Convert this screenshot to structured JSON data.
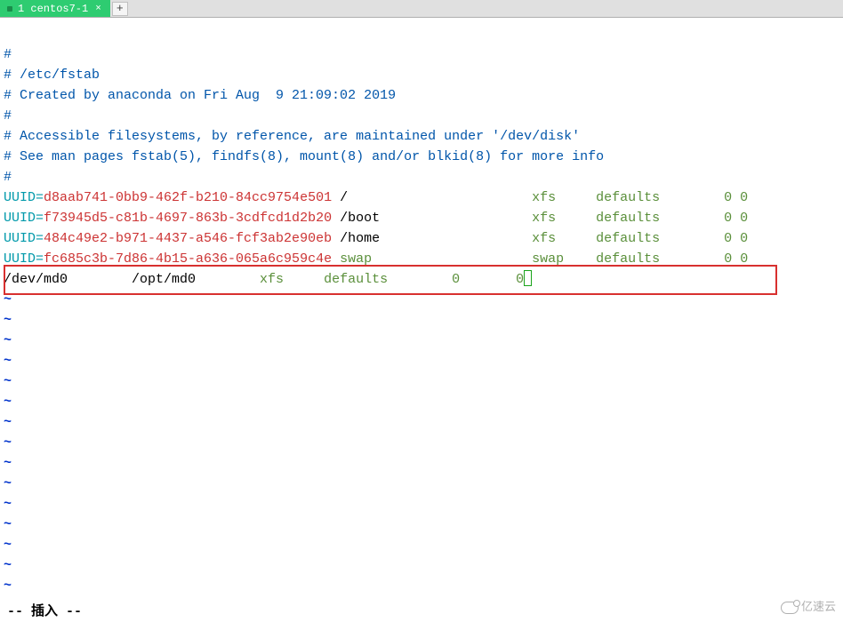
{
  "tab": {
    "title": "1 centos7-1",
    "close": "×",
    "add": "+"
  },
  "file": {
    "comment1": "#",
    "comment2": "# /etc/fstab",
    "comment3": "# Created by anaconda on Fri Aug  9 21:09:02 2019",
    "comment4": "#",
    "comment5": "# Accessible filesystems, by reference, are maintained under '/dev/disk'",
    "comment6": "# See man pages fstab(5), findfs(8), mount(8) and/or blkid(8) for more info",
    "comment7": "#",
    "entries": [
      {
        "key": "UUID=",
        "val": "d8aab741-0bb9-462f-b210-84cc9754e501",
        "mount": " /                       ",
        "fs": "xfs     ",
        "opt": "defaults        ",
        "nums": "0 0"
      },
      {
        "key": "UUID=",
        "val": "f73945d5-c81b-4697-863b-3cdfcd1d2b20",
        "mount": " /boot                   ",
        "fs": "xfs     ",
        "opt": "defaults        ",
        "nums": "0 0"
      },
      {
        "key": "UUID=",
        "val": "484c49e2-b971-4437-a546-fcf3ab2e90eb",
        "mount": " /home                   ",
        "fs": "xfs     ",
        "opt": "defaults        ",
        "nums": "0 0"
      },
      {
        "key": "UUID=",
        "val": "fc685c3b-7d86-4b15-a636-065a6c959c4e",
        "mount": " ",
        "swap": "swap",
        "pad": "                    ",
        "fs": "swap    ",
        "opt": "defaults        ",
        "nums": "0 0"
      }
    ],
    "newline": {
      "dev": "/dev/md0        /opt/md0        ",
      "fs": "xfs     ",
      "opt": "defaults        ",
      "n1": "0       ",
      "n2": "0"
    }
  },
  "tilde": "~",
  "status": "-- 插入 --",
  "watermark": "亿速云"
}
